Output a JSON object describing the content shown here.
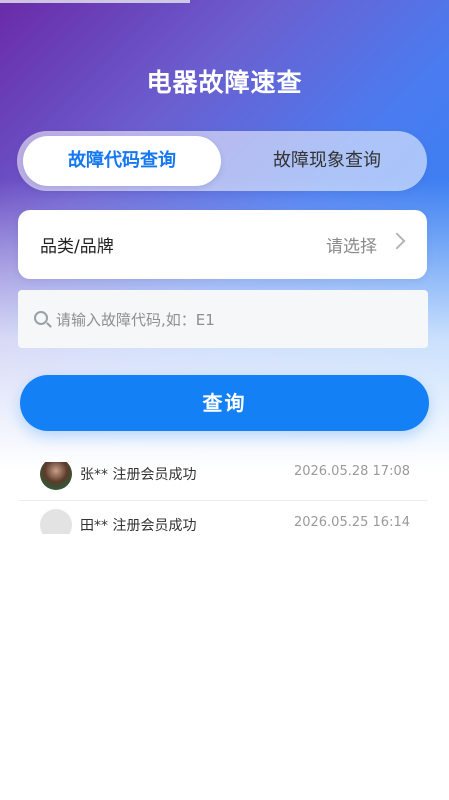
{
  "app": {
    "title": "电器故障速查"
  },
  "tabs": [
    {
      "label": "故障代码查询",
      "active": true
    },
    {
      "label": "故障现象查询",
      "active": false
    }
  ],
  "category": {
    "label": "品类/品牌",
    "value": "请选择"
  },
  "search": {
    "placeholder": "请输入故障代码,如：E1",
    "value": ""
  },
  "query_button": {
    "label": "查询"
  },
  "feed": [
    {
      "text": "张** 注册会员成功",
      "time": "2026.05.28 17:08"
    },
    {
      "text": "田** 注册会员成功",
      "time": "2026.05.25 16:14"
    }
  ],
  "colors": {
    "accent": "#1380f5",
    "title": "#ffffff",
    "tab_active_text": "#1578f0"
  },
  "icons": {
    "search": "search-icon",
    "chevron": "chevron-right-icon"
  }
}
